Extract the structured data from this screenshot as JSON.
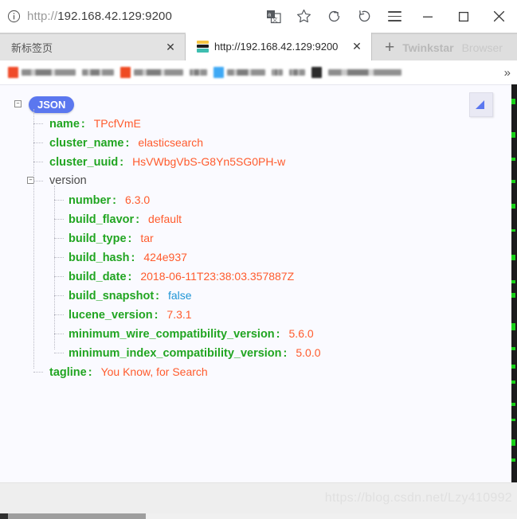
{
  "browser": {
    "address_bar": {
      "scheme": "http://",
      "host": "192.168.42.129:9200",
      "full_url": "http://192.168.42.129:9200",
      "info_icon": "info-circle-icon"
    },
    "toolbar_icons": [
      {
        "name": "translate-icon",
        "glyph": "translate"
      },
      {
        "name": "bookmark-star-icon",
        "glyph": "star"
      },
      {
        "name": "reload-icon",
        "glyph": "refresh"
      },
      {
        "name": "history-icon",
        "glyph": "history"
      },
      {
        "name": "menu-icon",
        "glyph": "hamburger"
      }
    ],
    "window_controls": [
      {
        "name": "minimize-button",
        "glyph": "minus"
      },
      {
        "name": "maximize-button",
        "glyph": "square"
      },
      {
        "name": "close-button",
        "glyph": "cross"
      }
    ],
    "tabs": [
      {
        "title": "新标签页",
        "active": false,
        "close_label": "✕"
      },
      {
        "title": "http://192.168.42.129:9200",
        "active": true,
        "close_label": "✕"
      }
    ],
    "new_tab": {
      "plus_label": "+",
      "brand_primary": "Twinkstar",
      "brand_secondary": "Browser"
    },
    "bookmarks_overflow": "»",
    "status_bar": {
      "watermark": "https://blog.csdn.net/Lzy410992"
    }
  },
  "viewer": {
    "root_badge": "JSON",
    "collapse_glyph": "–",
    "colon": ":",
    "rows": [
      {
        "indent": 1,
        "key": "name",
        "value": "TPcfVmE",
        "type": "string"
      },
      {
        "indent": 1,
        "key": "cluster_name",
        "value": "elasticsearch",
        "type": "string"
      },
      {
        "indent": 1,
        "key": "cluster_uuid",
        "value": "HsVWbgVbS-G8Yn5SG0PH-w",
        "type": "string"
      },
      {
        "indent": 1,
        "key": "version",
        "value": "",
        "type": "object"
      },
      {
        "indent": 2,
        "key": "number",
        "value": "6.3.0",
        "type": "string"
      },
      {
        "indent": 2,
        "key": "build_flavor",
        "value": "default",
        "type": "string"
      },
      {
        "indent": 2,
        "key": "build_type",
        "value": "tar",
        "type": "string"
      },
      {
        "indent": 2,
        "key": "build_hash",
        "value": "424e937",
        "type": "string"
      },
      {
        "indent": 2,
        "key": "build_date",
        "value": "2018-06-11T23:38:03.357887Z",
        "type": "string"
      },
      {
        "indent": 2,
        "key": "build_snapshot",
        "value": "false",
        "type": "boolean"
      },
      {
        "indent": 2,
        "key": "lucene_version",
        "value": "7.3.1",
        "type": "string"
      },
      {
        "indent": 2,
        "key": "minimum_wire_compatibility_version",
        "value": "5.6.0",
        "type": "string"
      },
      {
        "indent": 2,
        "key": "minimum_index_compatibility_version",
        "value": "5.0.0",
        "type": "string"
      },
      {
        "indent": 1,
        "key": "tagline",
        "value": "You Know, for Search",
        "type": "string"
      }
    ]
  },
  "colors": {
    "key_green": "#21a521",
    "value_orange": "#ff5b2d",
    "boolean_blue": "#2196d6",
    "badge_blue": "#5b77ef",
    "content_bg": "#fafaff"
  }
}
